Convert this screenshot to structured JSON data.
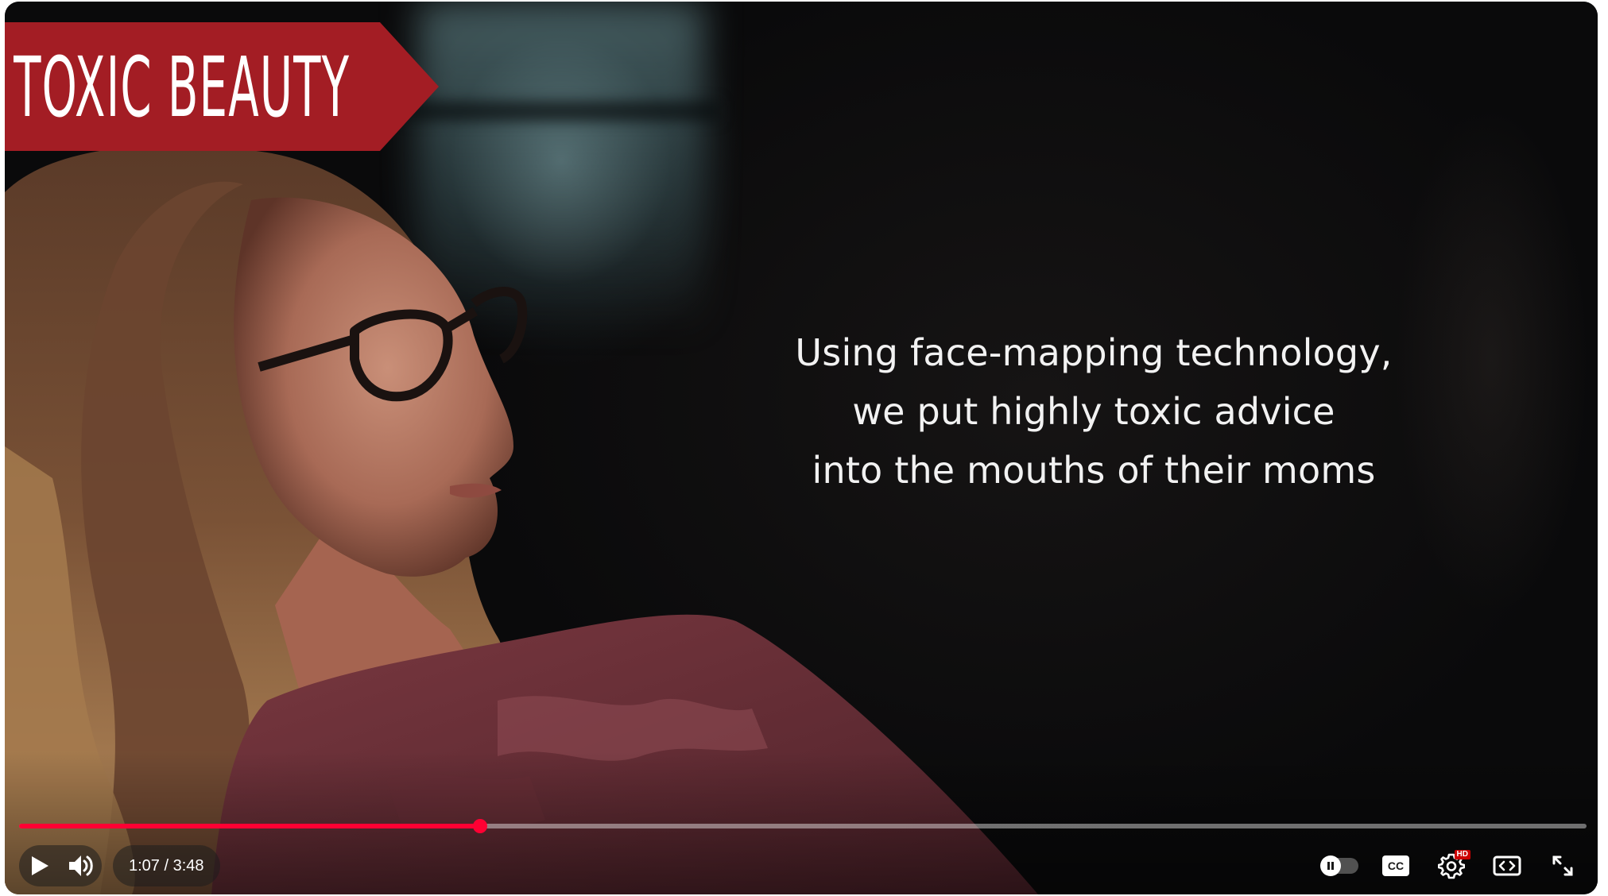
{
  "banner": {
    "text": ": TOXIC BEAUTY",
    "color": "#a31d24"
  },
  "video": {
    "subtitle_lines": [
      "Using face-mapping technology,",
      "we put highly toxic advice",
      "into the mouths of their moms"
    ]
  },
  "player": {
    "time": "1:07 / 3:48",
    "progress_fraction": 0.294,
    "accent": "#ff0033",
    "hd_badge": "HD",
    "icons": {
      "play": "play-icon",
      "volume": "volume-icon",
      "autoplay": "autoplay-toggle",
      "captions": "cc-icon",
      "settings": "gear-icon",
      "theater": "theater-mode-icon",
      "fullscreen": "fullscreen-icon"
    }
  }
}
